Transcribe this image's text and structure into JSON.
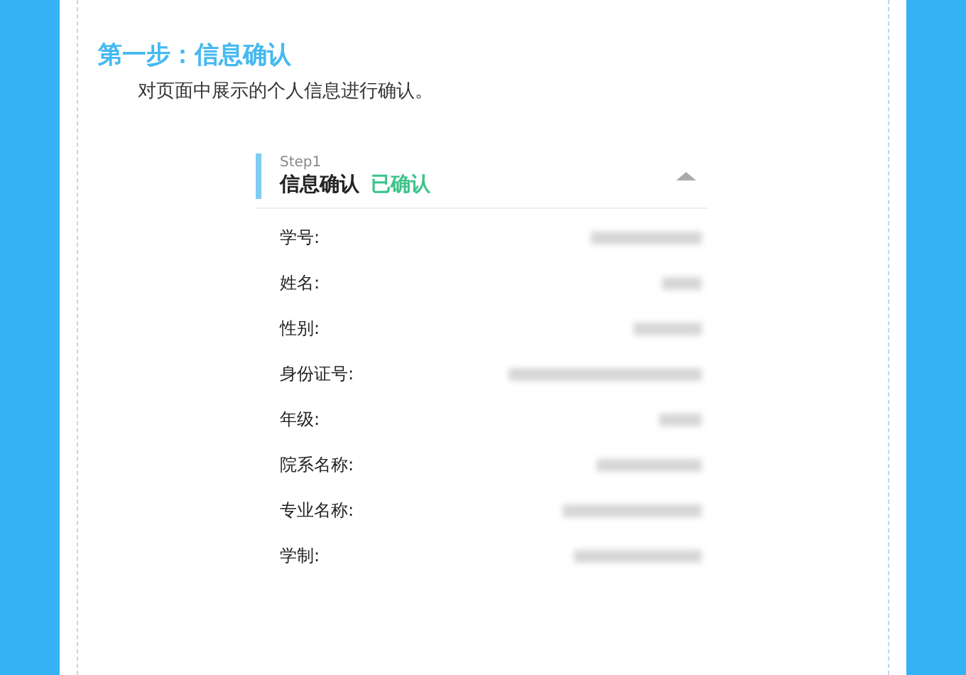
{
  "section": {
    "heading": "第一步：信息确认",
    "description": "对页面中展示的个人信息进行确认。"
  },
  "card": {
    "step": "Step1",
    "title": "信息确认",
    "status": "已确认",
    "expanded": true,
    "fields": [
      {
        "label": "学号:"
      },
      {
        "label": "姓名:"
      },
      {
        "label": "性别:"
      },
      {
        "label": "身份证号:"
      },
      {
        "label": "年级:"
      },
      {
        "label": "院系名称:"
      },
      {
        "label": "专业名称:"
      },
      {
        "label": "学制:"
      }
    ]
  }
}
